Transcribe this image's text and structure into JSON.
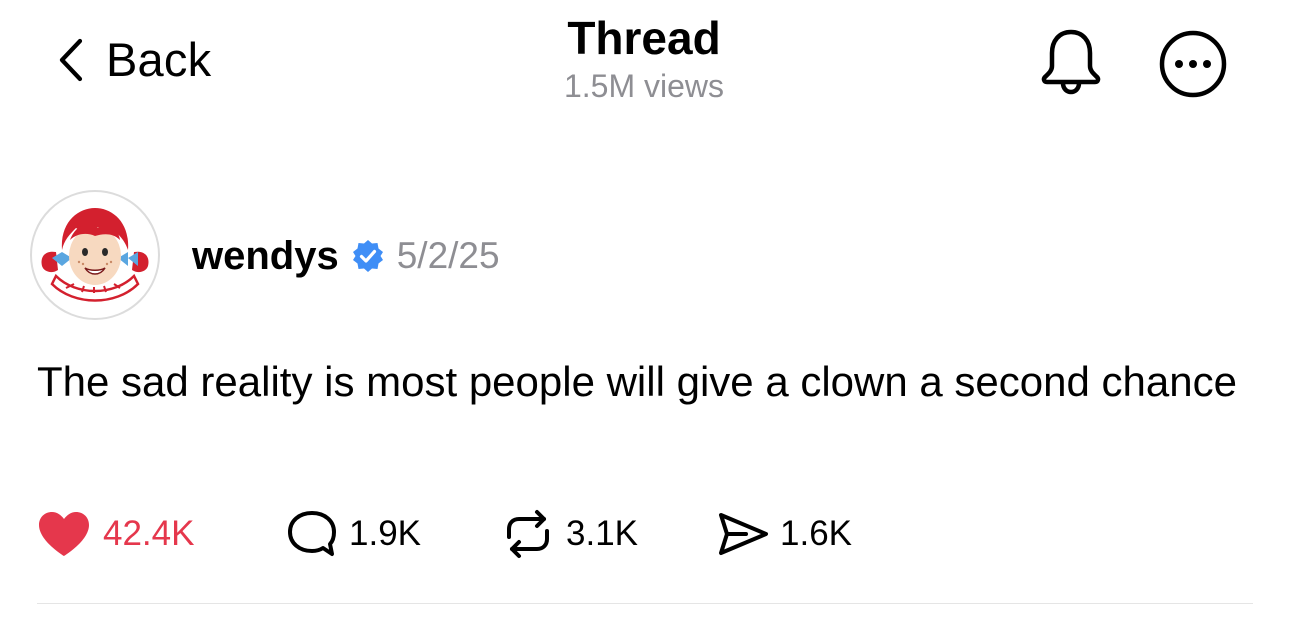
{
  "header": {
    "back_label": "Back",
    "title": "Thread",
    "views": "1.5M views",
    "notify_icon": "bell-icon",
    "more_icon": "more-options-icon"
  },
  "post": {
    "author": "wendys",
    "verified": true,
    "verified_color": "#3f8ef6",
    "date": "5/2/25",
    "text": "The sad reality is most people will give a clown a second chance",
    "avatar_logo_text": "Wendy's",
    "actions": {
      "likes": "42.4K",
      "replies": "1.9K",
      "reposts": "3.1K",
      "shares": "1.6K"
    }
  },
  "colors": {
    "like": "#e5374c",
    "muted": "#8e8e93",
    "divider": "#e5e5e5"
  }
}
